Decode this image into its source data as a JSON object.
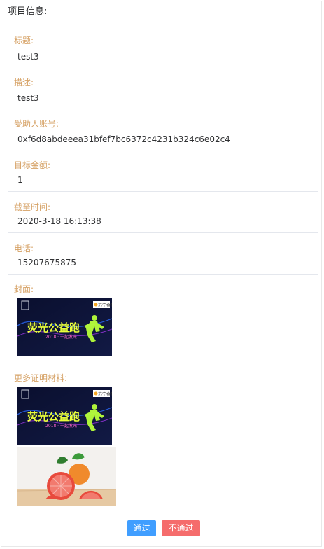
{
  "header": {
    "title": "项目信息:"
  },
  "fields": {
    "title": {
      "label": "标题:",
      "value": "test3"
    },
    "description": {
      "label": "描述:",
      "value": "test3"
    },
    "beneficiary_account": {
      "label": "受助人账号:",
      "value": "0xf6d8abdeeea31bfef7bc6372c4231b324c6e02c4"
    },
    "target_amount": {
      "label": "目标金额:",
      "value": "1"
    },
    "deadline": {
      "label": "截至时间:",
      "value": "2020-3-18 16:13:38"
    },
    "phone": {
      "label": "电话:",
      "value": "15207675875"
    },
    "cover": {
      "label": "封面:"
    },
    "more_materials": {
      "label": "更多证明材料:"
    }
  },
  "poster": {
    "headline": "荧光公益跑",
    "subline": "2018 · 一起发光",
    "sponsor": "苏宁金融"
  },
  "actions": {
    "approve_label": "通过",
    "reject_label": "不通过"
  },
  "colors": {
    "label": "#d6a266",
    "approve": "#409eff",
    "reject": "#f56c6c"
  }
}
